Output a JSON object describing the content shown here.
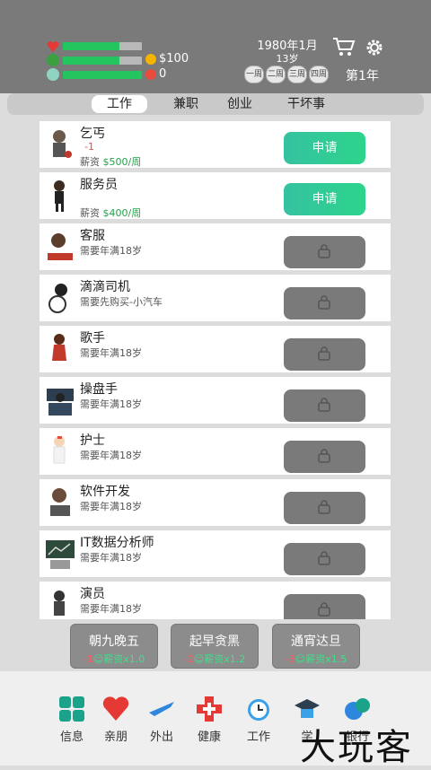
{
  "stats": {
    "money": "$100",
    "coins": "0"
  },
  "date": "1980年1月",
  "age": "13岁",
  "weeks": [
    "一周",
    "二周",
    "三周",
    "四周"
  ],
  "year": "第1年",
  "tabs": [
    "工作",
    "兼职",
    "创业",
    "干坏事"
  ],
  "jobs": [
    {
      "name": "乞丐",
      "mood": "-1",
      "salary_label": "薪资",
      "salary": "$500/周",
      "status": "open",
      "button": "申请"
    },
    {
      "name": "服务员",
      "salary_label": "薪资",
      "salary": "$400/周",
      "status": "open",
      "button": "申请"
    },
    {
      "name": "客服",
      "req": "需要年满18岁",
      "status": "locked"
    },
    {
      "name": "滴滴司机",
      "req": "需要先购买-小汽车",
      "status": "locked"
    },
    {
      "name": "歌手",
      "req": "需要年满18岁",
      "status": "locked"
    },
    {
      "name": "操盘手",
      "req": "需要年满18岁",
      "status": "locked"
    },
    {
      "name": "护士",
      "req": "需要年满18岁",
      "status": "locked"
    },
    {
      "name": "软件开发",
      "req": "需要年满18岁",
      "status": "locked"
    },
    {
      "name": "IT数据分析师",
      "req": "需要年满18岁",
      "status": "locked"
    },
    {
      "name": "演员",
      "req": "需要年满18岁",
      "status": "locked"
    }
  ],
  "shifts": [
    {
      "label": "朝九晚五",
      "cost": "-1",
      "bonus": "薪资x1.0"
    },
    {
      "label": "起早贪黑",
      "cost": "-2",
      "bonus": "薪资x1.2"
    },
    {
      "label": "通宵达旦",
      "cost": "-3",
      "bonus": "薪资x1.5"
    }
  ],
  "nav": [
    "信息",
    "亲朋",
    "外出",
    "健康",
    "工作",
    "学",
    "银行"
  ],
  "watermark": "大玩客",
  "colors": {
    "header": "#7a7a7a",
    "bar_fill": "#22c55e",
    "apply": "#2dd48c",
    "locked": "#7a7a7a"
  }
}
